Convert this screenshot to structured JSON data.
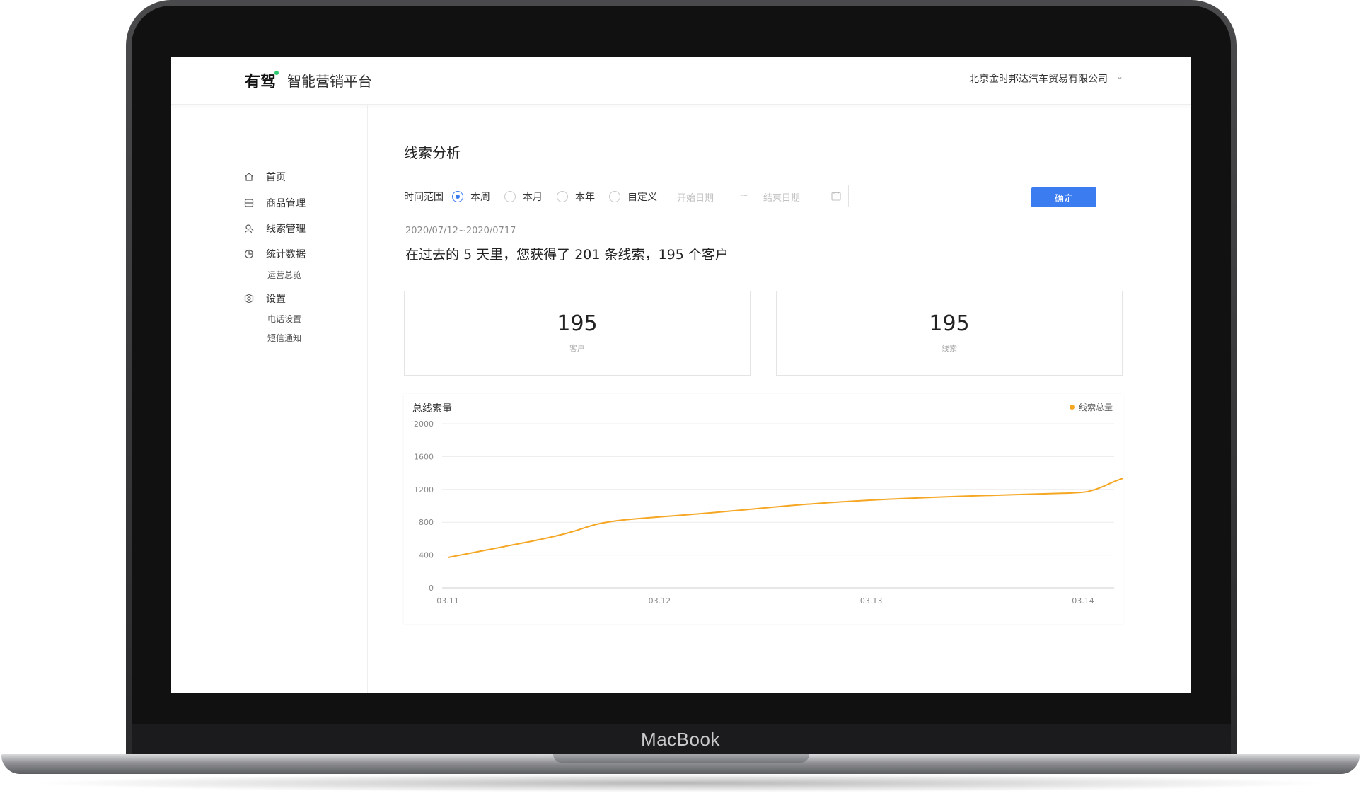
{
  "device": {
    "brand": "MacBook"
  },
  "header": {
    "logo": "有驾",
    "app_title": "智能营销平台",
    "company": "北京金时邦达汽车贸易有限公司",
    "company_chevron": "⌄"
  },
  "sidebar": {
    "items": [
      {
        "label": "首页",
        "icon": "home-icon"
      },
      {
        "label": "商品管理",
        "icon": "box-icon"
      },
      {
        "label": "线索管理",
        "icon": "user-icon"
      },
      {
        "label": "统计数据",
        "icon": "pie-chart-icon",
        "children": [
          "运营总览"
        ]
      },
      {
        "label": "设置",
        "icon": "gear-icon",
        "children": [
          "电话设置",
          "短信通知"
        ]
      }
    ]
  },
  "main": {
    "title": "线索分析",
    "filter": {
      "label": "时间范围",
      "options": [
        "本周",
        "本月",
        "本年",
        "自定义"
      ],
      "selected": "本周",
      "start_placeholder": "开始日期",
      "separator": "~",
      "end_placeholder": "结束日期",
      "confirm_label": "确定"
    },
    "date_range": "2020/07/12~2020/0717",
    "summary": "在过去的 5 天里，您获得了 201 条线索，195 个客户",
    "stats": [
      {
        "value": "195",
        "label": "客户"
      },
      {
        "value": "195",
        "label": "线索"
      }
    ]
  },
  "colors": {
    "accent": "#3b7cf0",
    "line": "#f5a623"
  },
  "chart_data": {
    "type": "line",
    "title": "总线索量",
    "legend_position": "top-right",
    "grid": true,
    "ylim": [
      0,
      2000
    ],
    "y_ticks": [
      "2000",
      "1600",
      "1200",
      "800",
      "400",
      "0"
    ],
    "x_ticks": [
      "03.11",
      "03.12",
      "03.13",
      "03.14"
    ],
    "series": [
      {
        "name": "线索总量",
        "x": [
          0,
          0.1,
          0.2,
          0.3,
          0.4,
          0.5,
          0.6,
          0.7,
          0.8,
          0.9,
          1.0,
          1.2,
          1.4,
          1.6,
          1.8,
          2.0,
          2.2,
          2.4,
          2.6,
          2.8,
          3.0,
          3.05,
          3.1,
          3.15,
          3.2
        ],
        "values": [
          370,
          420,
          470,
          520,
          570,
          625,
          690,
          780,
          820,
          845,
          865,
          905,
          950,
          1000,
          1040,
          1070,
          1095,
          1115,
          1130,
          1145,
          1160,
          1190,
          1240,
          1300,
          1345
        ]
      }
    ]
  }
}
